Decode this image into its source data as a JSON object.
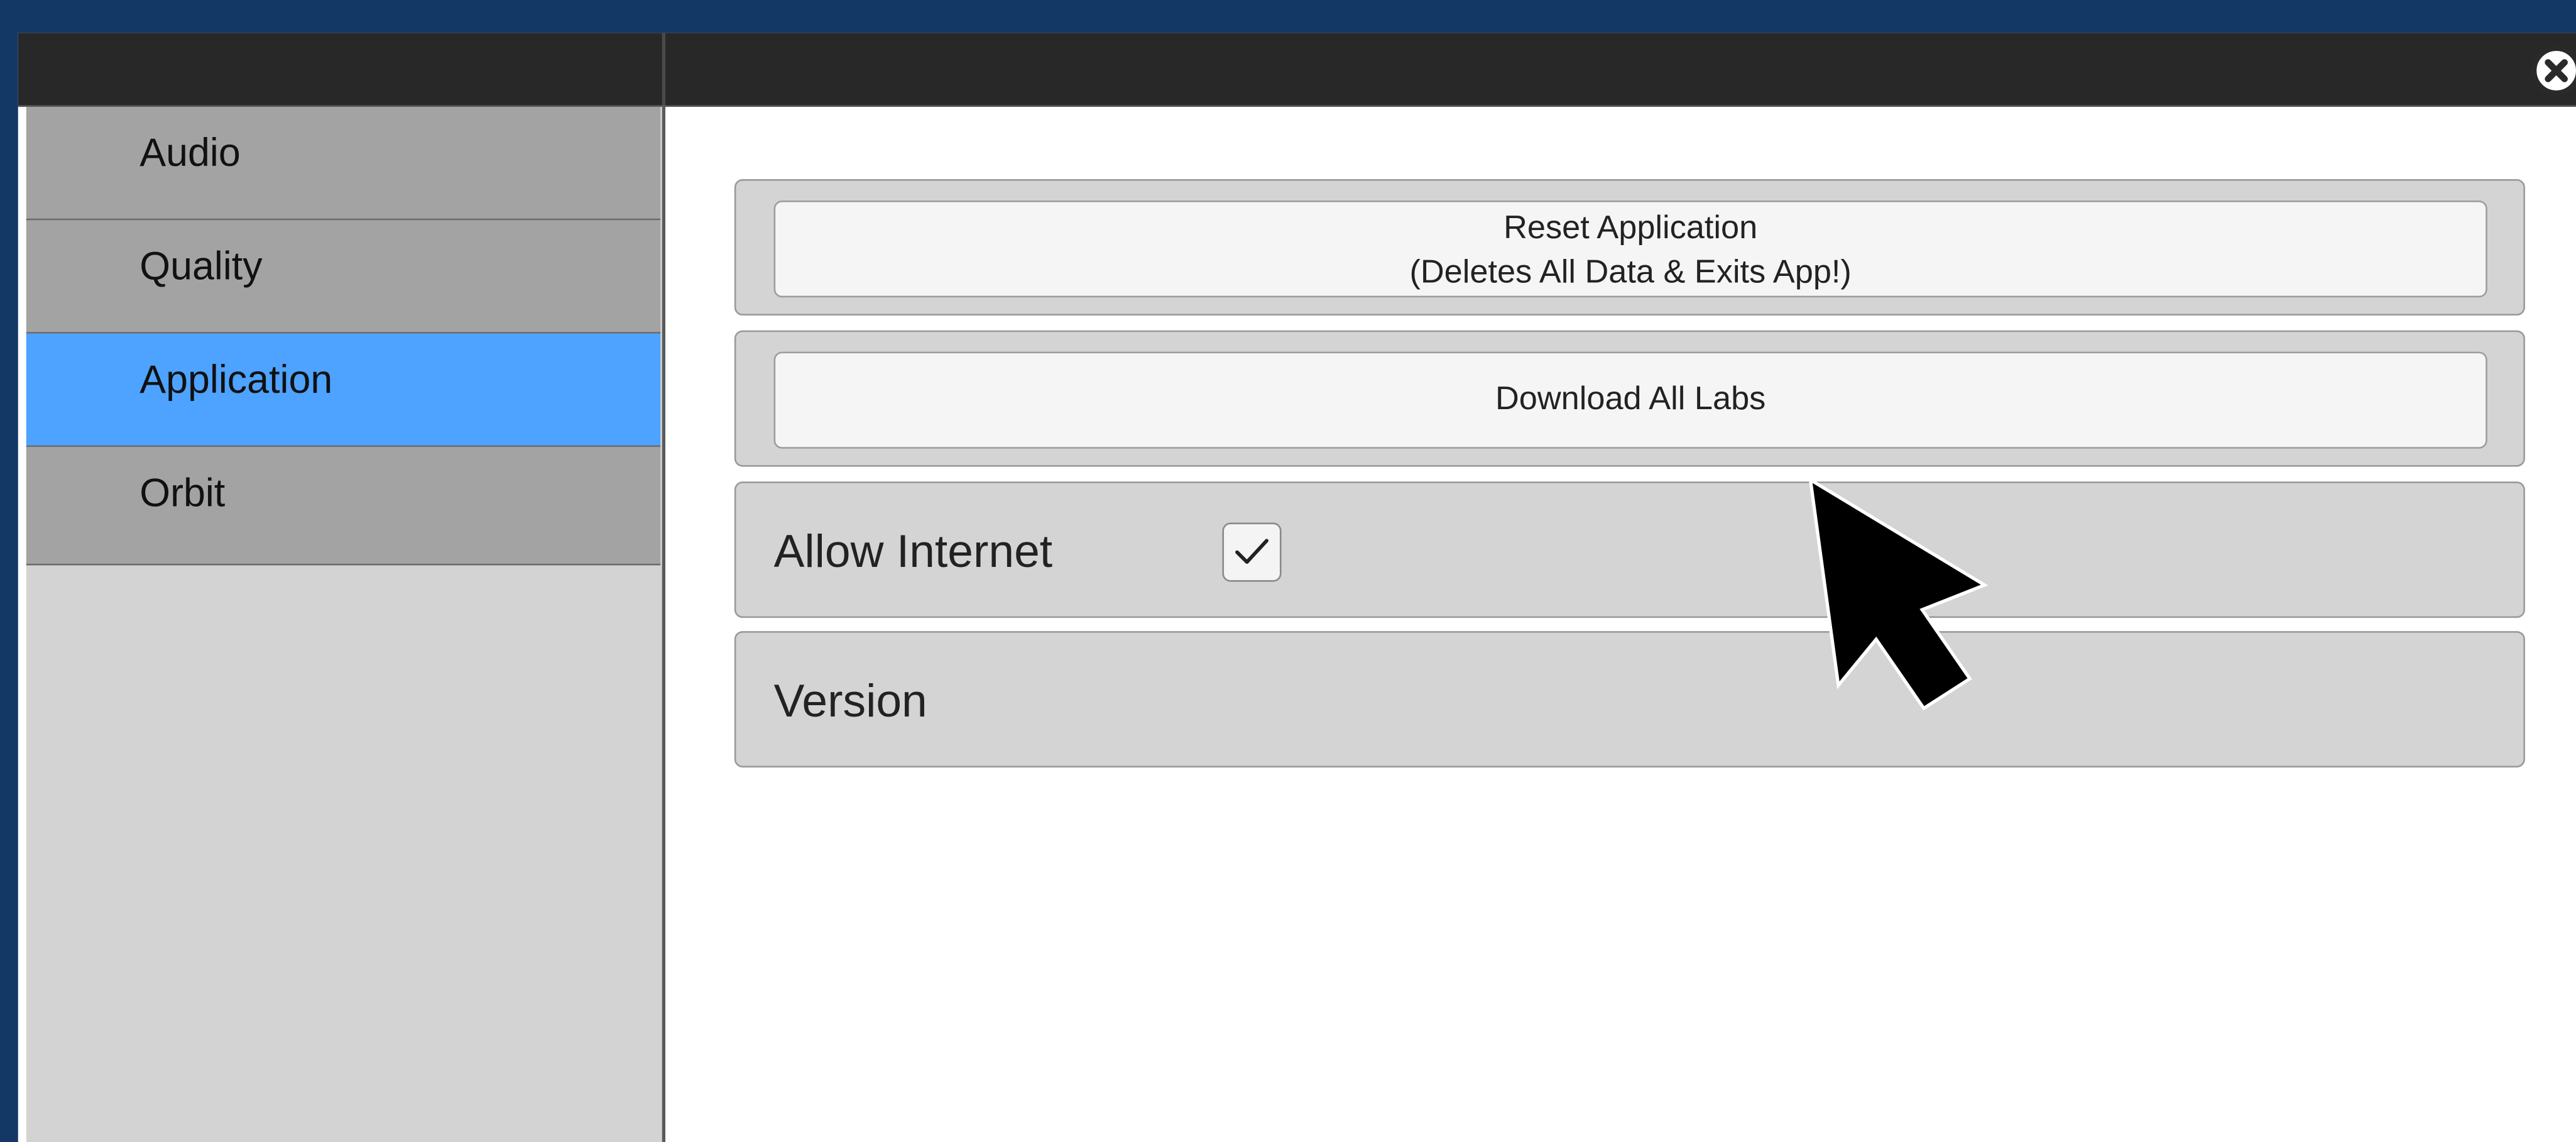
{
  "sidebar": {
    "items": [
      {
        "label": "Audio",
        "active": false
      },
      {
        "label": "Quality",
        "active": false
      },
      {
        "label": "Application",
        "active": true
      },
      {
        "label": "Orbit",
        "active": false
      }
    ]
  },
  "main": {
    "reset_button": {
      "line1": "Reset Application",
      "line2": "(Deletes All Data & Exits App!)"
    },
    "download_button": {
      "label": "Download All Labs"
    },
    "allow_internet": {
      "label": "Allow Internet",
      "checked": true
    },
    "version": {
      "label": "Version"
    }
  },
  "icons": {
    "close": "close-icon",
    "check": "checkmark-icon",
    "cursor": "mouse-pointer-icon"
  },
  "colors": {
    "background": "#143866",
    "titlebar": "#282828",
    "active_tab": "#4da3ff",
    "tab": "#a3a3a3"
  }
}
